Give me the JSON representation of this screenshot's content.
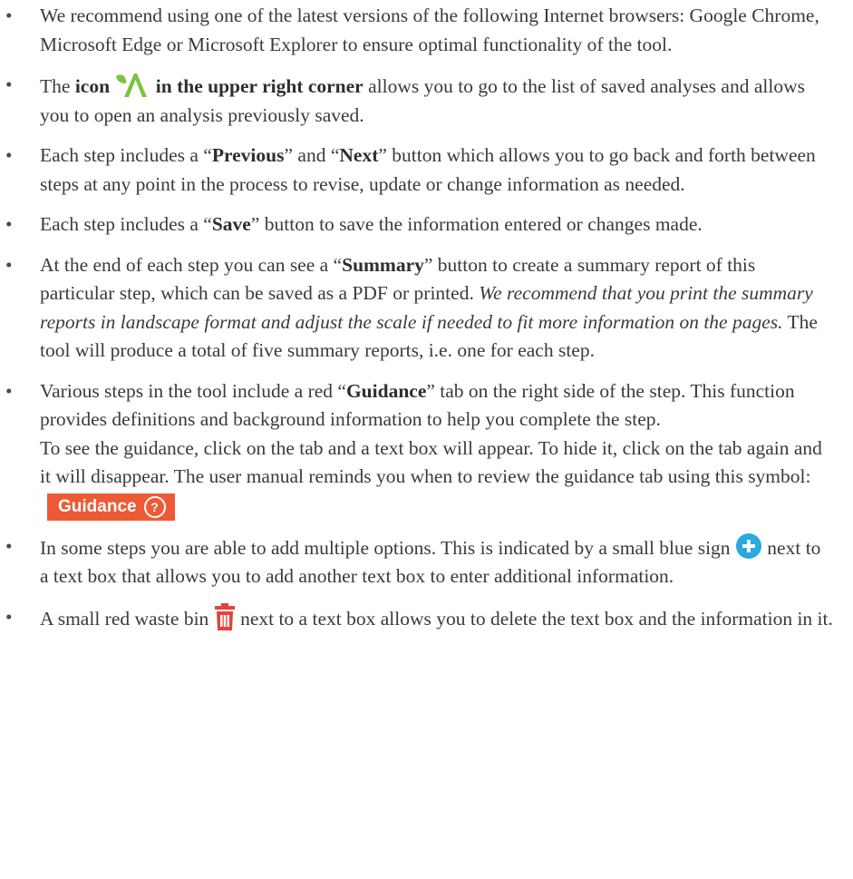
{
  "colors": {
    "text": "#3a3a3a",
    "guidance_red": "#ee5a36",
    "plus_blue": "#2aa8e0",
    "bin_red": "#e8403a",
    "logo_green": "#7cc242"
  },
  "bullets": {
    "b1": {
      "text": "We recommend using one of the latest versions of the following Internet browsers: Google Chrome, Microsoft Edge or Microsoft Explorer to ensure optimal functionality of the tool."
    },
    "b2": {
      "pre": "The ",
      "bold1": "icon",
      "bold2": "in the upper right corner",
      "post": " allows you to go to the list of saved analyses and allows you to open an analysis previously saved.",
      "icon": "saved-analyses-logo-icon"
    },
    "b3": {
      "t1": "Each step includes a “",
      "bold1": "Previous",
      "t2": "” and “",
      "bold2": "Next",
      "t3": "” button which allows you to go back and forth between steps at any point in the process to revise, update or change information as needed."
    },
    "b4": {
      "t1": "Each step includes a “",
      "bold1": "Save",
      "t2": "” button to save the information entered or changes made."
    },
    "b5": {
      "t1": "At the end of each step you can see a “",
      "bold1": "Summary",
      "t2": "” button to create a summary report of this particular step, which can be saved as a PDF or printed. ",
      "italic": "We recommend that you print the summary reports in landscape format and adjust the scale if needed to fit more information on the pages.",
      "t3": " The tool will produce a total of five summary reports, i.e. one for each step."
    },
    "b6": {
      "t1": "Various steps in the tool include a red “",
      "bold1": "Guidance",
      "t2": "” tab on the right side of the step. This function provides definitions and background information to help you complete the step.",
      "p2": "To see the guidance, click on the tab and a text box will appear. To hide it, click on the tab again and it will disappear. The user manual reminds you when to review the guidance tab using this symbol:",
      "badge_label": "Guidance",
      "badge_icon": "question-icon",
      "badge_q": "?"
    },
    "b7": {
      "t1": "In some steps you are able to add multiple options. This is indicated by a small blue sign ",
      "t2": " next to a text box that allows you to add another text box to enter additional information.",
      "icon": "plus-circle-icon"
    },
    "b8": {
      "t1": "A small red waste bin ",
      "t2": " next to a text box allows you to delete the text box and the information in it.",
      "icon": "trash-bin-icon"
    }
  }
}
